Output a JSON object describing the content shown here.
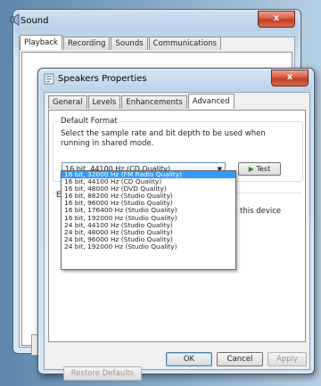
{
  "sound_window": {
    "title": "Sound",
    "close_label": "x",
    "tabs": [
      {
        "label": "Playback",
        "active": true
      },
      {
        "label": "Recording",
        "active": false
      },
      {
        "label": "Sounds",
        "active": false
      },
      {
        "label": "Communications",
        "active": false
      }
    ]
  },
  "props_window": {
    "title": "Speakers Properties",
    "close_label": "x",
    "tabs": [
      {
        "label": "General",
        "active": false
      },
      {
        "label": "Levels",
        "active": false
      },
      {
        "label": "Enhancements",
        "active": false
      },
      {
        "label": "Advanced",
        "active": true
      }
    ],
    "default_format": {
      "group_label": "Default Format",
      "description": "Select the sample rate and bit depth to be used when running in shared mode.",
      "selected": "16 bit, 44100 Hz (CD Quality)",
      "test_label": "Test"
    },
    "exclusive": {
      "label_start": "E",
      "text_end": "this device"
    },
    "dropdown_options": [
      {
        "label": "16 bit, 32000 Hz (FM Radio Quality)",
        "highlighted": true
      },
      {
        "label": "16 bit, 44100 Hz (CD Quality)",
        "highlighted": false
      },
      {
        "label": "16 bit, 48000 Hz (DVD Quality)",
        "highlighted": false
      },
      {
        "label": "16 bit, 88200 Hz (Studio Quality)",
        "highlighted": false
      },
      {
        "label": "16 bit, 96000 Hz (Studio Quality)",
        "highlighted": false
      },
      {
        "label": "16 bit, 176400 Hz (Studio Quality)",
        "highlighted": false
      },
      {
        "label": "16 bit, 192000 Hz (Studio Quality)",
        "highlighted": false
      },
      {
        "label": "24 bit, 44100 Hz (Studio Quality)",
        "highlighted": false
      },
      {
        "label": "24 bit, 48000 Hz (Studio Quality)",
        "highlighted": false
      },
      {
        "label": "24 bit, 96000 Hz (Studio Quality)",
        "highlighted": false
      },
      {
        "label": "24 bit, 192000 Hz (Studio Quality)",
        "highlighted": false
      }
    ],
    "restore_label": "Restore Defaults",
    "ok_label": "OK",
    "cancel_label": "Cancel",
    "apply_label": "Apply"
  },
  "colors": {
    "selection": "#3399ff",
    "close_button": "#c23a20",
    "test_icon": "#2f8f1f"
  }
}
